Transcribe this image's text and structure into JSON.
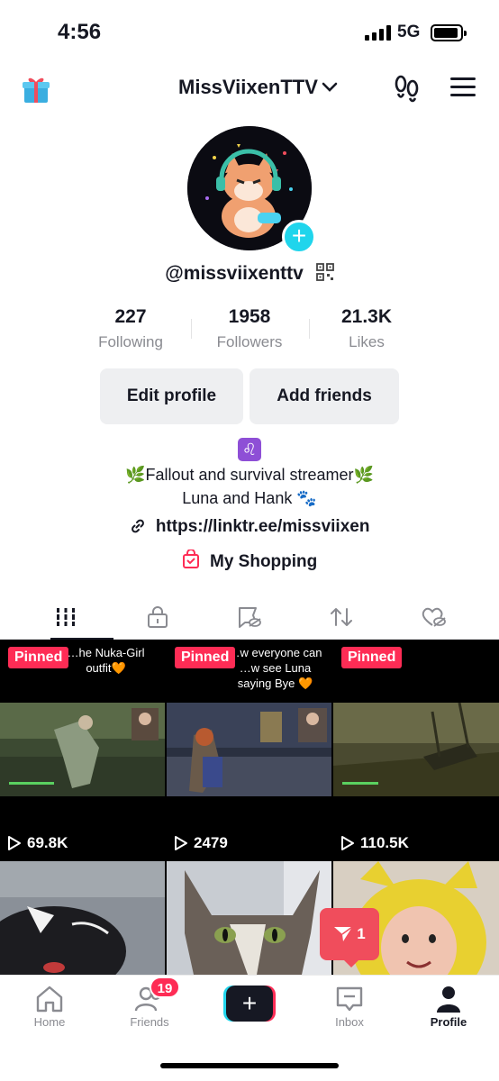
{
  "status_bar": {
    "time": "4:56",
    "network": "5G"
  },
  "header": {
    "username": "MissViixenTTV"
  },
  "profile": {
    "handle": "@missviixenttv",
    "stats": [
      {
        "value": "227",
        "label": "Following"
      },
      {
        "value": "1958",
        "label": "Followers"
      },
      {
        "value": "21.3K",
        "label": "Likes"
      }
    ],
    "buttons": {
      "edit": "Edit profile",
      "add_friends": "Add friends"
    },
    "bio": {
      "zodiac": "♌",
      "line1": "🌿Fallout and survival streamer🌿",
      "line2": "Luna and Hank 🐾"
    },
    "link": "https://linktr.ee/missviixen",
    "shopping": "My Shopping"
  },
  "tabs": [
    "videos",
    "private",
    "favorites-hidden",
    "reposts",
    "liked-hidden"
  ],
  "videos": [
    {
      "pinned": "Pinned",
      "caption": "…he Nuka-Girl outfit🧡",
      "views": "69.8K"
    },
    {
      "pinned": "Pinned",
      "caption": "…w everyone can …w see Luna saying Bye 🧡",
      "views": "2479"
    },
    {
      "pinned": "Pinned",
      "caption": "",
      "views": "110.5K"
    },
    {
      "pinned": "",
      "caption": "",
      "views": ""
    },
    {
      "pinned": "",
      "caption": "",
      "views": ""
    },
    {
      "pinned": "",
      "caption": "",
      "views": ""
    }
  ],
  "dm_badge": {
    "count": "1"
  },
  "bottom_nav": {
    "home": "Home",
    "friends": "Friends",
    "friends_badge": "19",
    "inbox": "Inbox",
    "profile": "Profile"
  },
  "colors": {
    "accent": "#fe2c55",
    "cyan": "#20d5ec",
    "text": "#161823",
    "muted": "#8a8b91"
  }
}
